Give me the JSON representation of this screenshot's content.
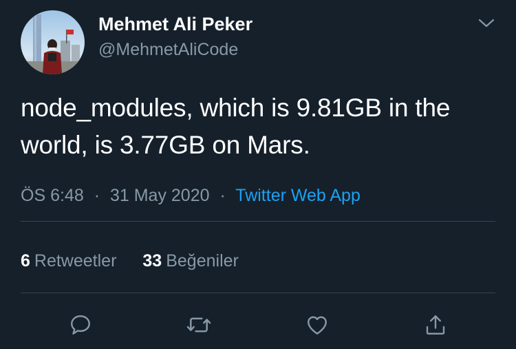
{
  "user": {
    "display_name": "Mehmet Ali Peker",
    "handle": "@MehmetAliCode"
  },
  "tweet": {
    "text_line1": "node_modules, which is 9.81GB in the",
    "text_line2": "world, is 3.77GB on Mars.",
    "time": "ÖS 6:48",
    "date": "31 May 2020",
    "separator": "·",
    "source": "Twitter Web App"
  },
  "stats": {
    "retweets_count": "6",
    "retweets_label": "Retweetler",
    "likes_count": "33",
    "likes_label": "Beğeniler"
  },
  "actions": {
    "icons": [
      "reply-icon",
      "retweet-icon",
      "like-icon",
      "share-icon"
    ]
  },
  "colors": {
    "background": "#15202b",
    "primary_text": "#ffffff",
    "secondary_text": "#8899a6",
    "accent": "#1da1f2",
    "divider": "#38444d"
  }
}
